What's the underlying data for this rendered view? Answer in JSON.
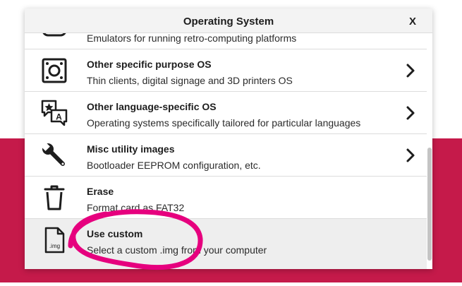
{
  "dialog": {
    "title": "Operating System",
    "close_label": "X",
    "items": [
      {
        "name": "",
        "description": "Emulators for running retro-computing platforms",
        "icon": "gamepad-icon",
        "has_submenu": false
      },
      {
        "name": "Other specific purpose OS",
        "description": "Thin clients, digital signage and 3D printers OS",
        "icon": "device-icon",
        "has_submenu": true
      },
      {
        "name": "Other language-specific OS",
        "description": "Operating systems specifically tailored for particular languages",
        "icon": "language-icon",
        "has_submenu": true
      },
      {
        "name": "Misc utility images",
        "description": "Bootloader EEPROM configuration, etc.",
        "icon": "wrench-icon",
        "has_submenu": true
      },
      {
        "name": "Erase",
        "description": "Format card as FAT32",
        "icon": "trash-icon",
        "has_submenu": false
      },
      {
        "name": "Use custom",
        "description": "Select a custom .img from your computer",
        "icon": "img-file-icon",
        "icon_text": ".img",
        "has_submenu": false,
        "selected": true
      }
    ]
  },
  "colors": {
    "background_band": "#c51a4a",
    "annotation_circle": "#e6007e",
    "selected_row": "#eeeeee"
  }
}
